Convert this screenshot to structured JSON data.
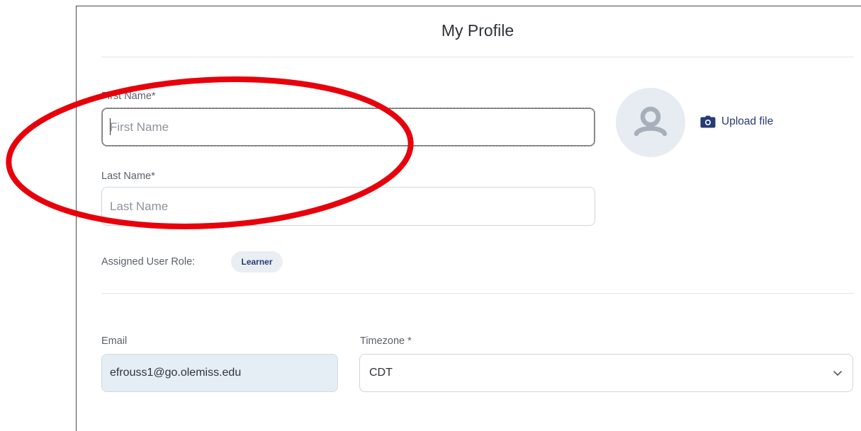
{
  "profile": {
    "title": "My Profile"
  },
  "form": {
    "first_name": {
      "label": "First Name*",
      "placeholder": "First Name",
      "value": ""
    },
    "last_name": {
      "label": "Last Name*",
      "placeholder": "Last Name",
      "value": ""
    },
    "upload_label": "Upload file",
    "role": {
      "label": "Assigned User Role:",
      "value": "Learner"
    },
    "email": {
      "label": "Email",
      "value": "efrouss1@go.olemiss.edu"
    },
    "timezone": {
      "label": "Timezone *",
      "selected": "CDT"
    }
  },
  "icons": {
    "avatar": "user-silhouette-icon",
    "upload": "camera-icon",
    "dropdown": "chevron-down-icon"
  },
  "colors": {
    "accent": "#263a74",
    "annotation": "#e8000b",
    "readonly_field": "#e6eef5",
    "badge_bg": "#e9eef3"
  }
}
